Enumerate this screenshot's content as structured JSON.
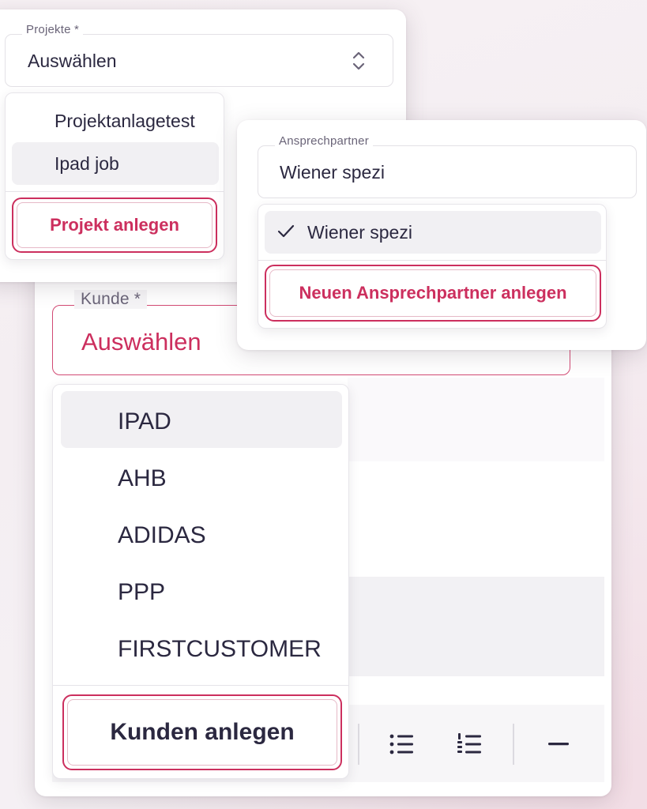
{
  "projekte": {
    "label": "Projekte *",
    "value": "Auswählen",
    "options": [
      "Projektanlagetest",
      "Ipad job"
    ],
    "create_label": "Projekt anlegen"
  },
  "ansprechpartner": {
    "label": "Ansprechpartner",
    "value": "Wiener spezi",
    "options": [
      {
        "label": "Wiener spezi",
        "selected": true
      }
    ],
    "create_label": "Neuen Ansprechpartner anlegen"
  },
  "kunde": {
    "label": "Kunde *",
    "value": "Auswählen",
    "options": [
      "IPAD",
      "AHB",
      "ADIDAS",
      "PPP",
      "FIRSTCUSTOMER"
    ],
    "create_label": "Kunden anlegen"
  },
  "toolbar": {
    "icons": [
      "bullet-list-icon",
      "numbered-list-icon",
      "horizontal-rule-icon"
    ]
  },
  "colors": {
    "accent": "#cc2f5e",
    "text": "#2b2840",
    "muted_label": "#6a6478",
    "highlight": "#f1f0f3"
  }
}
